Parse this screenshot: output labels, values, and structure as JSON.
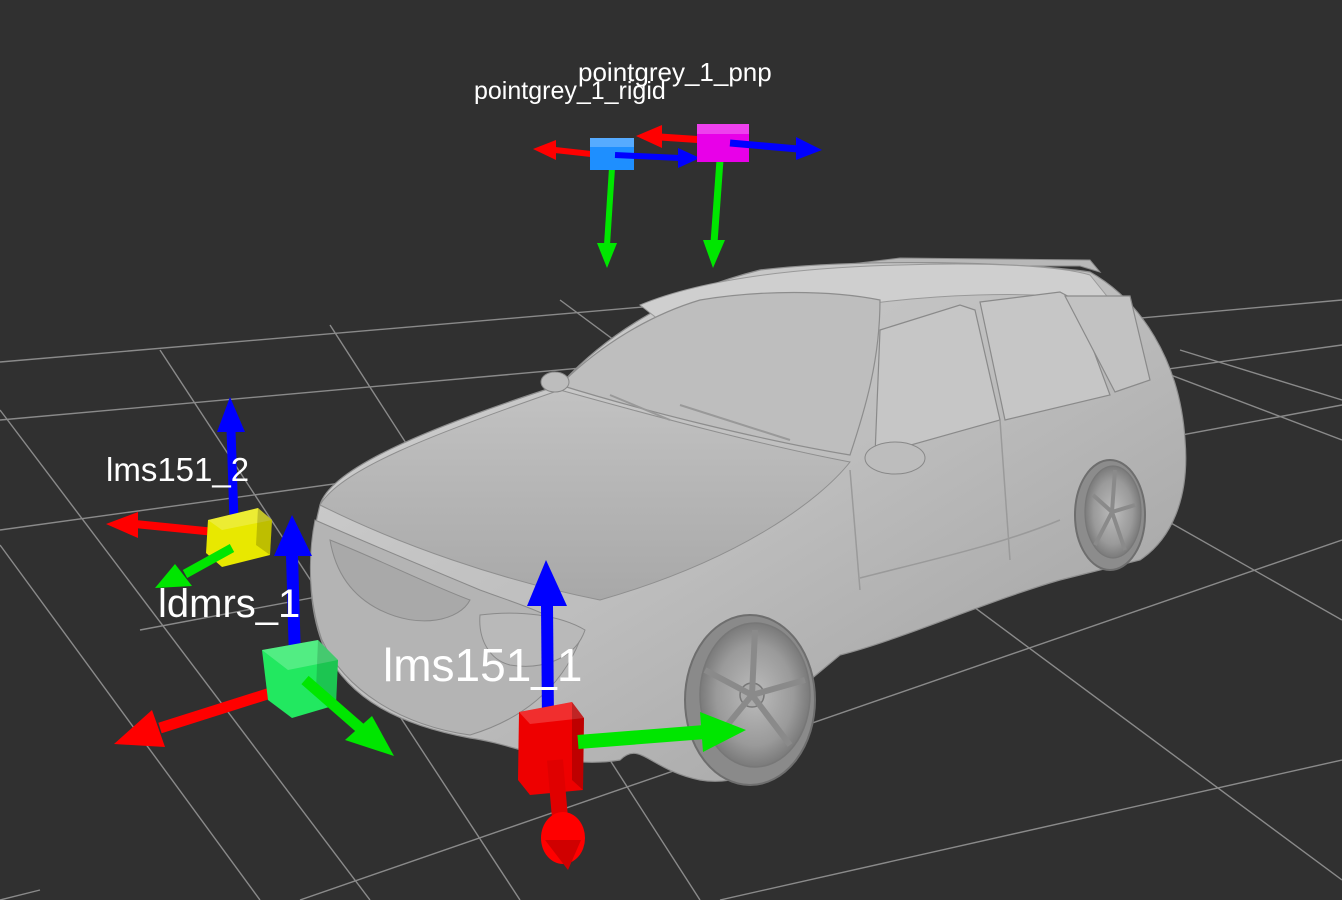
{
  "viewport": {
    "background_color": "#303030",
    "grid_color": "#9a9a9a",
    "model_color": "#c8c8c8"
  },
  "axis_colors": {
    "x": "#ff0000",
    "y": "#00ff00",
    "z": "#0000ff"
  },
  "frames": [
    {
      "id": "pointgrey_1_rigid",
      "label": "pointgrey_1_rigid",
      "box_color": "#1e8fff"
    },
    {
      "id": "pointgrey_1_pnp",
      "label": "pointgrey_1_pnp",
      "box_color": "#e800e8"
    },
    {
      "id": "lms151_2",
      "label": "lms151_2",
      "box_color": "#e8e800"
    },
    {
      "id": "ldmrs_1",
      "label": "ldmrs_1",
      "box_color": "#22e860"
    },
    {
      "id": "lms151_1",
      "label": "lms151_1",
      "box_color": "#ee0000"
    }
  ]
}
